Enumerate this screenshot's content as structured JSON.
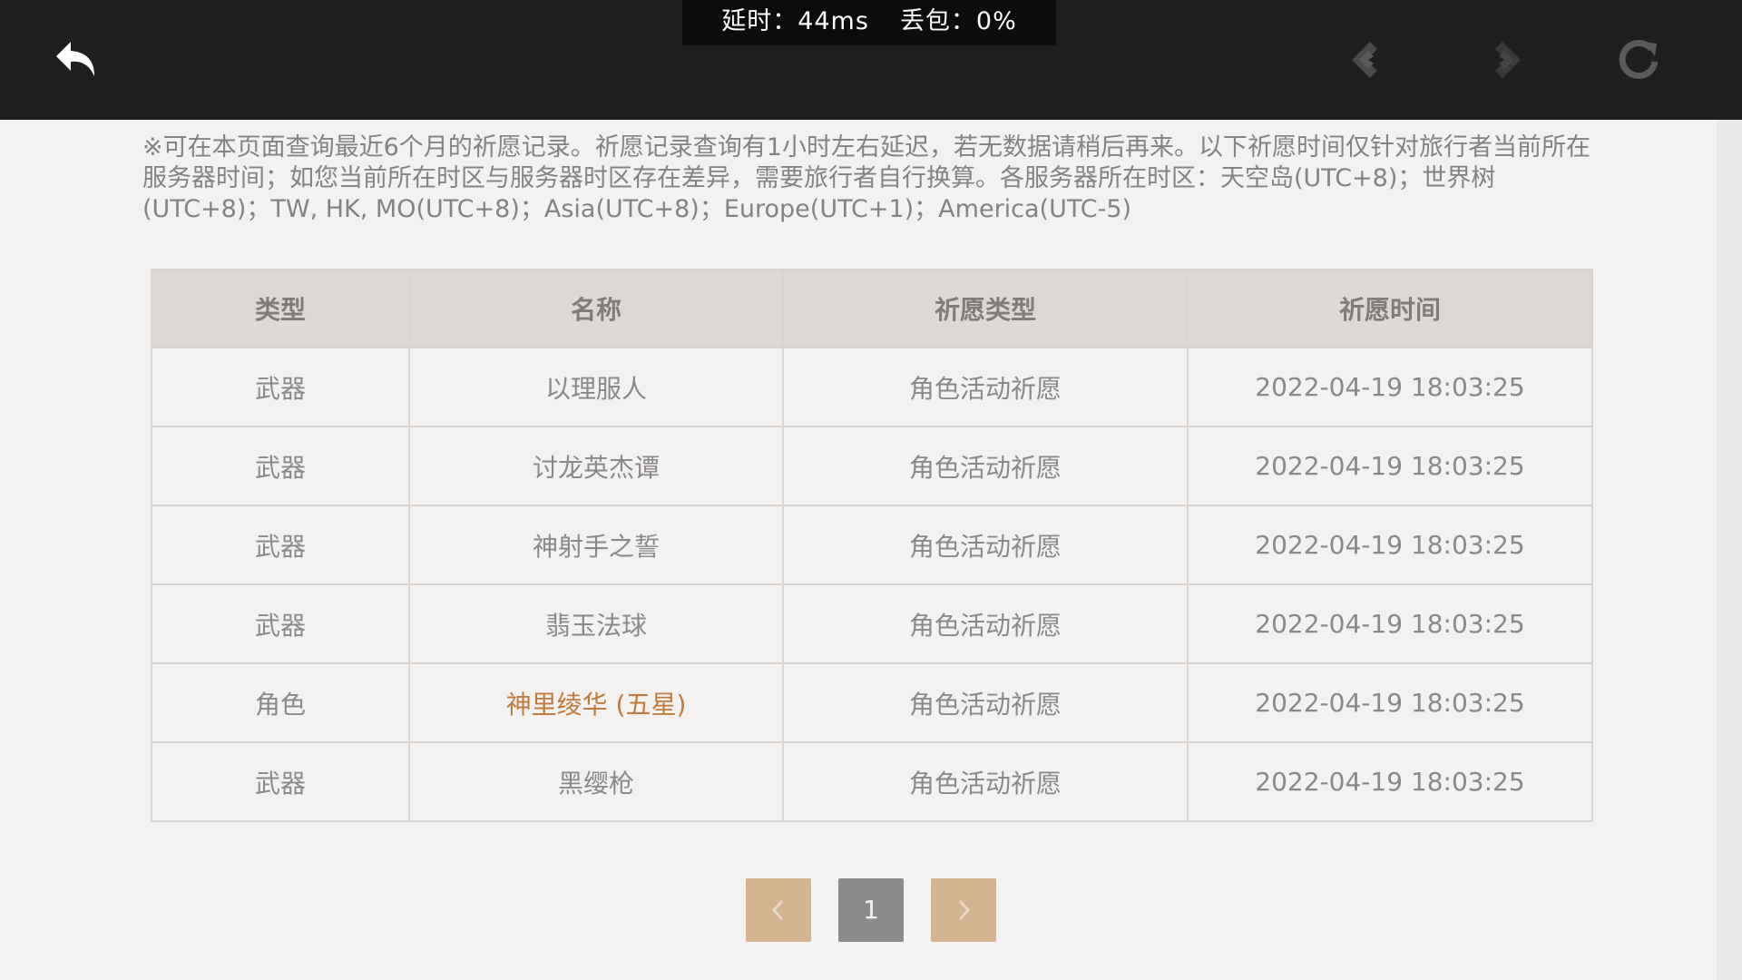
{
  "status": {
    "latency_label": "延时：44ms",
    "packet_loss_label": "丢包：0%"
  },
  "toolbar": {
    "back_icon": "back-arrow-icon",
    "prev_icon": "prev-diamond-icon",
    "next_icon": "next-diamond-icon",
    "refresh_icon": "refresh-icon"
  },
  "notice": "※可在本页面查询最近6个月的祈愿记录。祈愿记录查询有1小时左右延迟，若无数据请稍后再来。以下祈愿时间仅针对旅行者当前所在服务器时间；如您当前所在时区与服务器时区存在差异，需要旅行者自行换算。各服务器所在时区：天空岛(UTC+8)；世界树(UTC+8)；TW, HK, MO(UTC+8)；Asia(UTC+8)；Europe(UTC+1)；America(UTC-5)",
  "table": {
    "headers": [
      "类型",
      "名称",
      "祈愿类型",
      "祈愿时间"
    ],
    "rows": [
      [
        "武器",
        "以理服人",
        "角色活动祈愿",
        "2022-04-19 18:03:25"
      ],
      [
        "武器",
        "讨龙英杰谭",
        "角色活动祈愿",
        "2022-04-19 18:03:25"
      ],
      [
        "武器",
        "神射手之誓",
        "角色活动祈愿",
        "2022-04-19 18:03:25"
      ],
      [
        "武器",
        "翡玉法球",
        "角色活动祈愿",
        "2022-04-19 18:03:25"
      ],
      [
        "角色",
        "神里绫华 (五星)",
        "角色活动祈愿",
        "2022-04-19 18:03:25"
      ],
      [
        "武器",
        "黑缨枪",
        "角色活动祈愿",
        "2022-04-19 18:03:25"
      ]
    ]
  },
  "pagination": {
    "current_page": "1",
    "prev_icon": "chevron-left-icon",
    "next_icon": "chevron-right-icon"
  },
  "colors": {
    "topbar": "#1f1f1f",
    "background": "#f4f2f0",
    "header_bg": "#dcd8d3",
    "five_star": "#c07b3c",
    "pager_button": "#d4b48f",
    "pager_current": "#8d8b89"
  }
}
